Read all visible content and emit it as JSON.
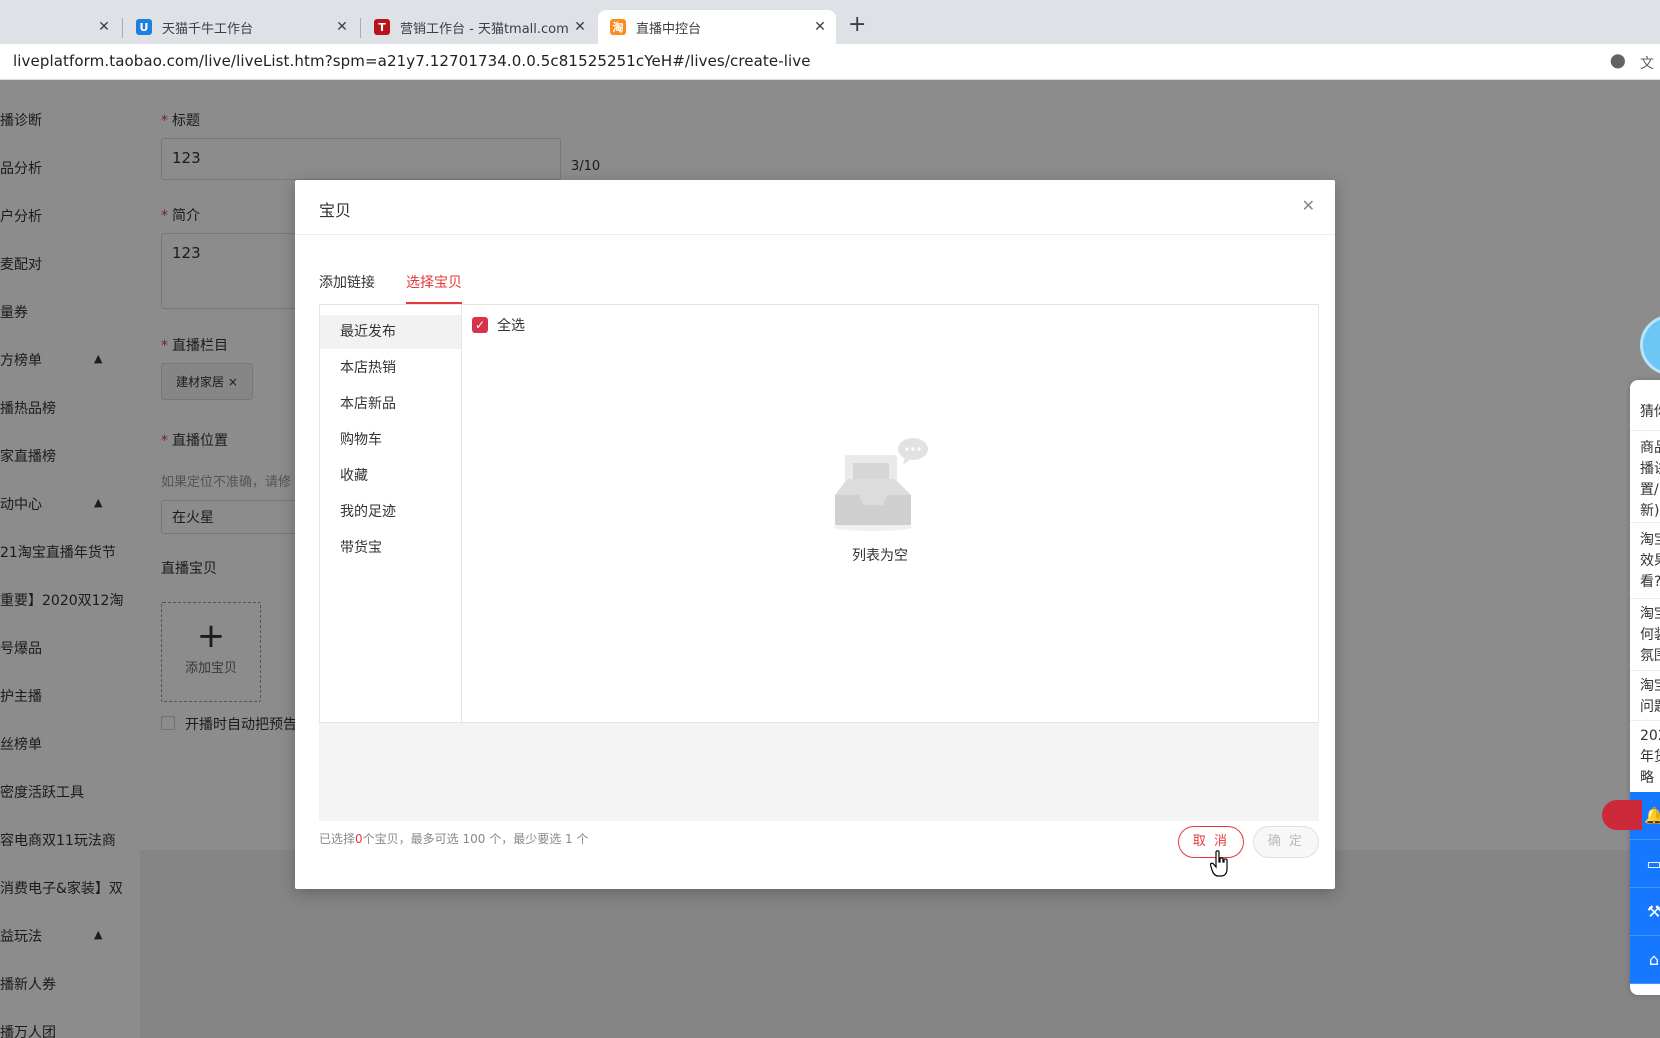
{
  "browser": {
    "tabs": [
      {
        "title": "",
        "active": false
      },
      {
        "title": "天猫千牛工作台",
        "active": false
      },
      {
        "title": "营销工作台 - 天猫tmall.com",
        "active": false
      },
      {
        "title": "直播中控台",
        "active": true
      }
    ],
    "url": "liveplatform.taobao.com/live/liveList.htm?spm=a21y7.12701734.0.0.5c81525251cYeH#/lives/create-live"
  },
  "sidebar": {
    "items": [
      "播诊断",
      "品分析",
      "户分析",
      "麦配对",
      "量券",
      "方榜单",
      "播热品榜",
      "家直播榜",
      "动中心",
      "21淘宝直播年货节",
      "重要】2020双12淘",
      "号爆品",
      "护主播",
      "丝榜单",
      "密度活跃工具",
      "容电商双11玩法商",
      "消费电子&家装】双",
      "益玩法",
      "播新人券",
      "播万人团"
    ]
  },
  "form": {
    "title_label": "标题",
    "title_value": "123",
    "title_count": "3/10",
    "intro_label": "简介",
    "intro_value": "123",
    "column_label": "直播栏目",
    "column_tag": "建材家居 ×",
    "location_label": "直播位置",
    "location_hint": "如果定位不准确，请修",
    "location_value": "在火星",
    "goods_label": "直播宝贝",
    "add_goods": "添加宝贝",
    "auto_preview": "开播时自动把预告"
  },
  "widget": {
    "items": [
      "猜你",
      "商品\n播讲\n置/\n新)",
      "淘宝\n效果\n看?",
      "淘宝\n何装\n氛围",
      "淘宝\n问题",
      "202\n年货\n略"
    ]
  },
  "modal": {
    "title": "宝贝",
    "tabs": [
      "添加链接",
      "选择宝贝"
    ],
    "active_tab": 1,
    "categories": [
      "最近发布",
      "本店热销",
      "本店新品",
      "购物车",
      "收藏",
      "我的足迹",
      "带货宝"
    ],
    "active_category": 0,
    "select_all": "全选",
    "select_all_checked": true,
    "empty_text": "列表为空",
    "footer_pre": "已选择",
    "footer_count": "0",
    "footer_post": "个宝贝，最多可选 100 个，最少要选 1 个",
    "cancel": "取 消",
    "ok": "确 定",
    "accent_color": "#e4393c"
  }
}
